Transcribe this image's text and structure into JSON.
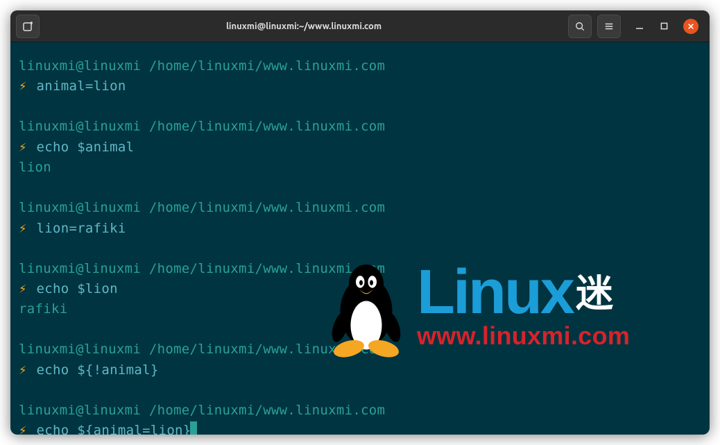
{
  "titlebar": {
    "title": "linuxmi@linuxmi:~/www.linuxmi.com"
  },
  "prompt": {
    "user_host": "linuxmi@linuxmi",
    "path": "/home/linuxmi/www.linuxmi.com",
    "symbol": "⚡"
  },
  "blocks": [
    {
      "cmd": "animal=lion",
      "output": null
    },
    {
      "cmd": "echo $animal",
      "output": "lion"
    },
    {
      "cmd": "lion=rafiki",
      "output": null
    },
    {
      "cmd": "echo $lion",
      "output": "rafiki"
    },
    {
      "cmd": "echo ${!animal}",
      "output": null
    }
  ],
  "current_cmd": "echo ${animal=lion}",
  "watermark": {
    "brand": "Linux",
    "kanji": "迷",
    "url": "www.linuxmi.com"
  },
  "colors": {
    "bg": "#003440",
    "teal": "#2aa198",
    "orange": "#f5a623",
    "brand_blue": "#1b9dd8",
    "brand_red": "#d8222a",
    "close": "#e95420"
  }
}
